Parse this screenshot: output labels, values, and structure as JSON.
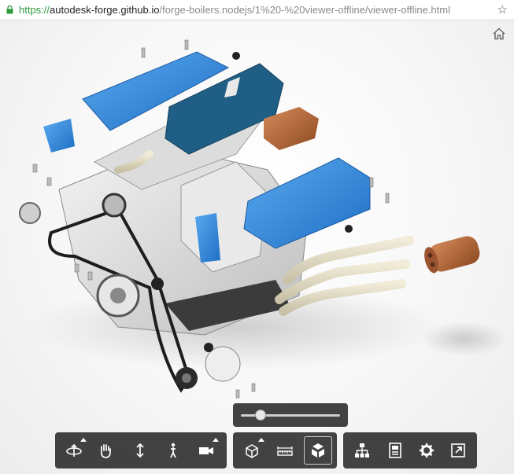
{
  "browser": {
    "url_scheme": "https://",
    "url_host": "autodesk-forge.github.io",
    "url_path": "/forge-boilers.nodejs/1%20-%20viewer-offline/viewer-offline.html",
    "star_icon": "star-outline-icon"
  },
  "viewer": {
    "home_icon": "home-icon",
    "explode_level": 0.2,
    "colors": {
      "accent_blue": "#2f86e0",
      "copper": "#b86a3a",
      "toolbar_bg": "#222222"
    }
  },
  "toolbar": {
    "navigation_group": [
      "orbit-icon",
      "pan-icon",
      "dolly-icon",
      "first-person-icon",
      "camera-icon"
    ],
    "modeling_group": [
      "section-box-icon",
      "measure-icon",
      "explode-icon"
    ],
    "settings_group": [
      "model-browser-icon",
      "properties-icon",
      "settings-gear-icon",
      "fullscreen-icon"
    ]
  }
}
